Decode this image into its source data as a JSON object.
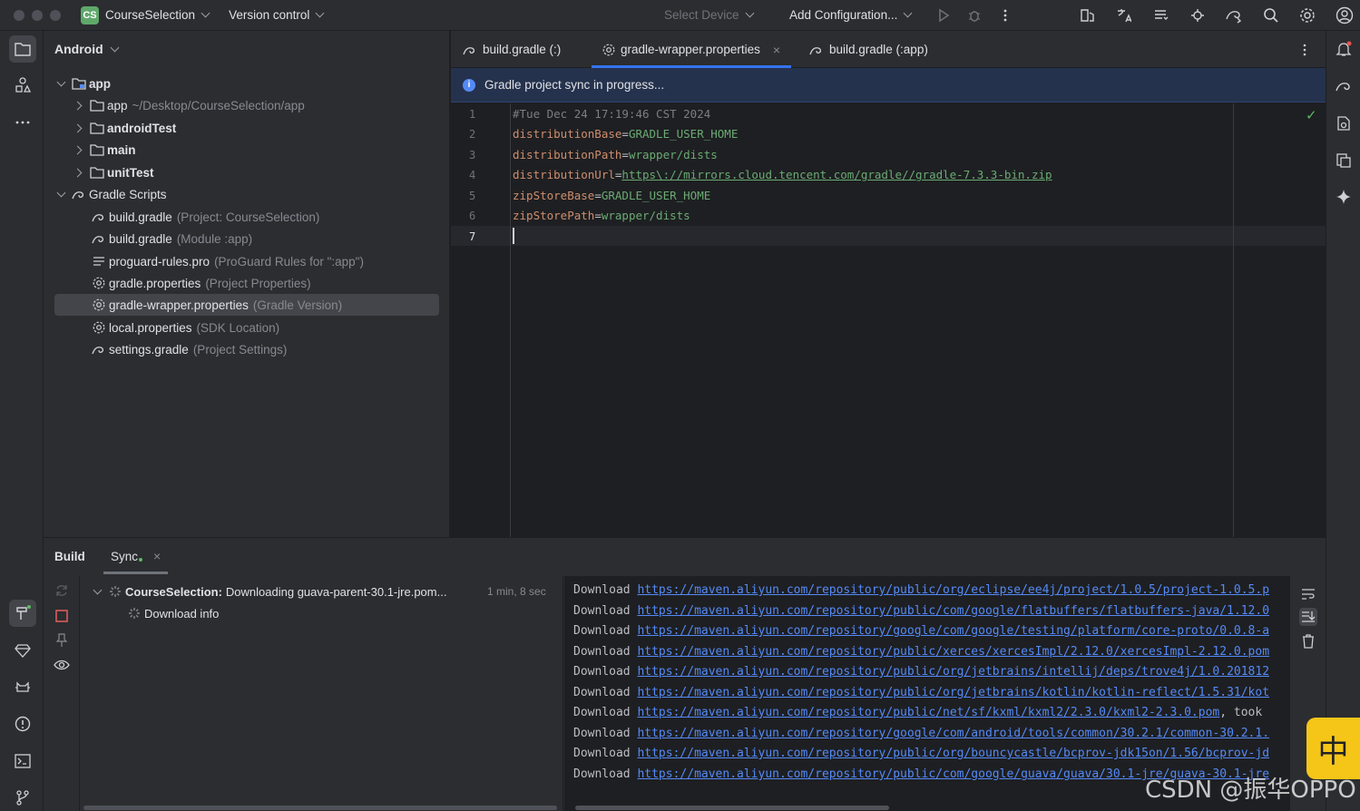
{
  "titlebar": {
    "project_badge": "CS",
    "project_name": "CourseSelection",
    "vcs": "Version control",
    "device": "Select Device",
    "run_config": "Add Configuration..."
  },
  "project_panel": {
    "title": "Android",
    "tree": [
      {
        "label": "app",
        "hint": "",
        "bold": true
      },
      {
        "label": "app",
        "hint": "~/Desktop/CourseSelection/app"
      },
      {
        "label": "androidTest",
        "hint": "",
        "bold": true
      },
      {
        "label": "main",
        "hint": "",
        "bold": true
      },
      {
        "label": "unitTest",
        "hint": "",
        "bold": true
      },
      {
        "label": "Gradle Scripts",
        "hint": ""
      },
      {
        "label": "build.gradle",
        "hint": "(Project: CourseSelection)"
      },
      {
        "label": "build.gradle",
        "hint": "(Module :app)"
      },
      {
        "label": "proguard-rules.pro",
        "hint": "(ProGuard Rules for \":app\")"
      },
      {
        "label": "gradle.properties",
        "hint": "(Project Properties)"
      },
      {
        "label": "gradle-wrapper.properties",
        "hint": "(Gradle Version)"
      },
      {
        "label": "local.properties",
        "hint": "(SDK Location)"
      },
      {
        "label": "settings.gradle",
        "hint": "(Project Settings)"
      }
    ]
  },
  "editor": {
    "tabs": [
      "build.gradle (:)",
      "gradle-wrapper.properties",
      "build.gradle (:app)"
    ],
    "banner": "Gradle project sync in progress...",
    "line_numbers": [
      "1",
      "2",
      "3",
      "4",
      "5",
      "6",
      "7"
    ],
    "lines": {
      "l1": "#Tue Dec 24 17:19:46 CST 2024",
      "l2k": "distributionBase",
      "l2v": "GRADLE_USER_HOME",
      "l3k": "distributionPath",
      "l3v": "wrapper/dists",
      "l4k": "distributionUrl",
      "l4v": "https\\://mirrors.cloud.tencent.com/gradle//gradle-7.3.3-bin.zip",
      "l5k": "zipStoreBase",
      "l5v": "GRADLE_USER_HOME",
      "l6k": "zipStorePath",
      "l6v": "wrapper/dists",
      "eq": "="
    }
  },
  "build_panel": {
    "tabs": [
      "Build",
      "Sync"
    ],
    "task_title": "CourseSelection:",
    "task_text": "Downloading guava-parent-30.1-jre.pom...",
    "task_time": "1 min, 8 sec",
    "sub_item": "Download info",
    "console": [
      {
        "prefix": "Download",
        "url": "https://maven.aliyun.com/repository/public/org/eclipse/ee4j/project/1.0.5/project-1.0.5.p",
        "suffix": ""
      },
      {
        "prefix": "Download",
        "url": "https://maven.aliyun.com/repository/public/com/google/flatbuffers/flatbuffers-java/1.12.0",
        "suffix": ""
      },
      {
        "prefix": "Download",
        "url": "https://maven.aliyun.com/repository/google/com/google/testing/platform/core-proto/0.0.8-a",
        "suffix": ""
      },
      {
        "prefix": "Download",
        "url": "https://maven.aliyun.com/repository/public/xerces/xercesImpl/2.12.0/xercesImpl-2.12.0.pom",
        "suffix": ""
      },
      {
        "prefix": "Download",
        "url": "https://maven.aliyun.com/repository/public/org/jetbrains/intellij/deps/trove4j/1.0.201812",
        "suffix": ""
      },
      {
        "prefix": "Download",
        "url": "https://maven.aliyun.com/repository/public/org/jetbrains/kotlin/kotlin-reflect/1.5.31/kot",
        "suffix": ""
      },
      {
        "prefix": "Download",
        "url": "https://maven.aliyun.com/repository/public/net/sf/kxml/kxml2/2.3.0/kxml2-2.3.0.pom",
        "suffix": ", took"
      },
      {
        "prefix": "Download",
        "url": "https://maven.aliyun.com/repository/google/com/android/tools/common/30.2.1/common-30.2.1.",
        "suffix": ""
      },
      {
        "prefix": "Download",
        "url": "https://maven.aliyun.com/repository/public/org/bouncycastle/bcprov-jdk15on/1.56/bcprov-jd",
        "suffix": ""
      },
      {
        "prefix": "Download",
        "url": "https://maven.aliyun.com/repository/public/com/google/guava/guava/30.1-jre/guava-30.1-jre",
        "suffix": ""
      }
    ]
  },
  "ime": "中",
  "watermark": "CSDN @振华OPPO",
  "colors": {
    "accent": "#3574f0",
    "banner": "#25324d",
    "ime": "#f5c518"
  }
}
